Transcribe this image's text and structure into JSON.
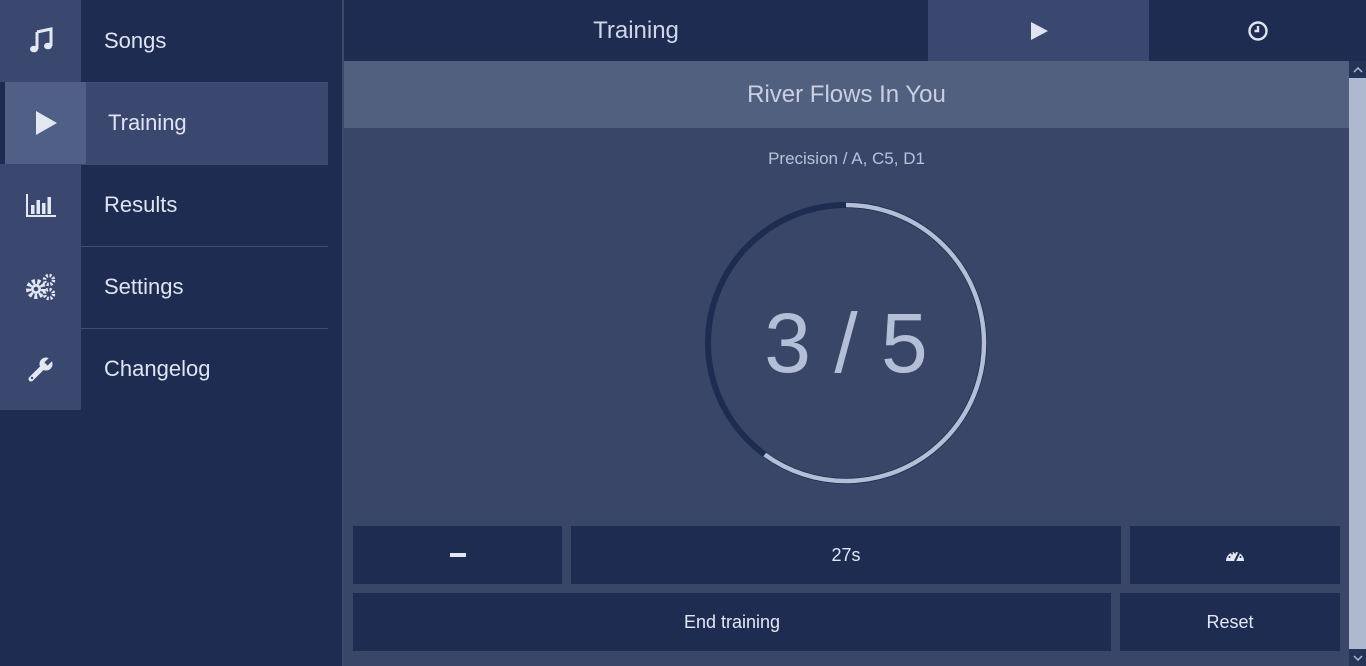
{
  "sidebar": {
    "items": [
      {
        "label": "Songs",
        "icon": "music-note-icon"
      },
      {
        "label": "Training",
        "icon": "play-icon",
        "active": true
      },
      {
        "label": "Results",
        "icon": "bar-chart-icon"
      },
      {
        "label": "Settings",
        "icon": "gears-icon"
      },
      {
        "label": "Changelog",
        "icon": "wrench-icon"
      }
    ]
  },
  "header": {
    "title": "Training",
    "play_icon": "play-icon",
    "clock_icon": "clock-icon"
  },
  "main": {
    "song_title": "River Flows In You",
    "subtitle": "Precision / A, C5, D1",
    "progress": {
      "current": 3,
      "total": 5,
      "text": "3 / 5",
      "fraction": 0.6
    },
    "controls": {
      "minus_icon": "minus-icon",
      "timer": "27s",
      "speed_icon": "tachometer-icon",
      "end_label": "End training",
      "reset_label": "Reset"
    }
  },
  "colors": {
    "background": "#1e2c51",
    "panel": "#394668",
    "header_band": "#52607f",
    "accent": "#b4bed6",
    "ring_track": "#1e2c51",
    "ring_fill": "#b4bed6"
  }
}
